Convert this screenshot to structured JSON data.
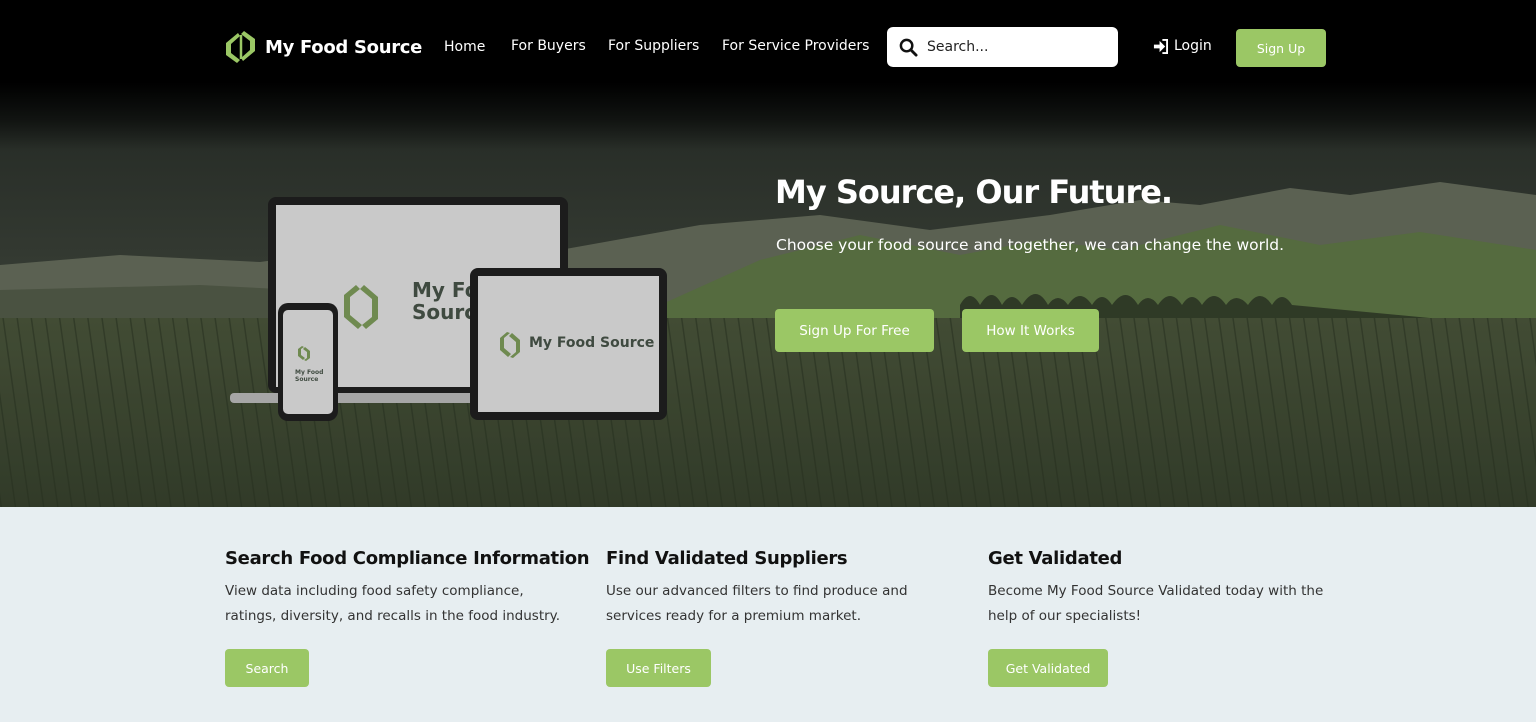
{
  "brand": {
    "name": "My Food Source",
    "accent": "#9bc765"
  },
  "nav": {
    "links": [
      "Home",
      "For Buyers",
      "For Suppliers",
      "For Service Providers"
    ],
    "search_placeholder": "Search...",
    "login_label": "Login",
    "signup_label": "Sign Up"
  },
  "hero": {
    "title": "My Source, Our Future.",
    "subtitle": "Choose your food source and together, we can change the world.",
    "primary_cta": "Sign Up For Free",
    "secondary_cta": "How It Works",
    "device_logo_text": "My Food Source",
    "laptop_logo_line1": "My Fo",
    "laptop_logo_line2": "Sourc",
    "phone_logo_line1": "My Food",
    "phone_logo_line2": "Source"
  },
  "features": [
    {
      "title": "Search Food Compliance Information",
      "body": "View data including food safety compliance, ratings, diversity, and recalls in the food industry.",
      "button": "Search"
    },
    {
      "title": "Find Validated Suppliers",
      "body": "Use our advanced filters to find produce and services ready for a premium market.",
      "button": "Use Filters"
    },
    {
      "title": "Get Validated",
      "body": "Become My Food Source Validated today with the help of our specialists!",
      "button": "Get Validated"
    }
  ]
}
